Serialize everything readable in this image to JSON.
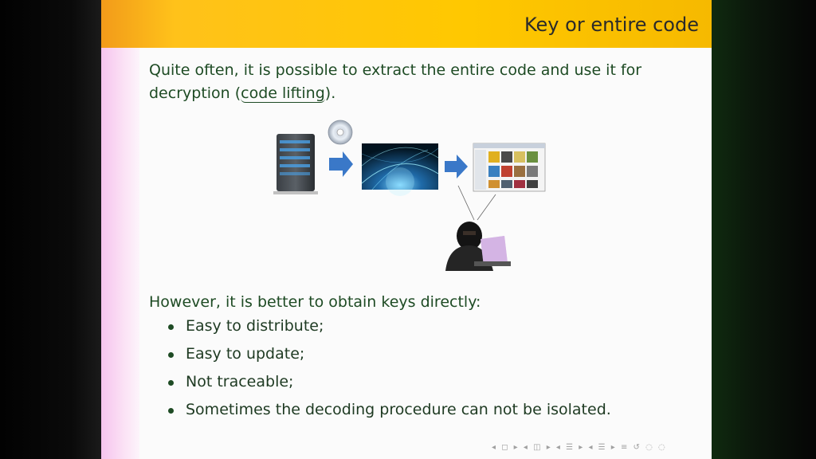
{
  "slide": {
    "title": "Key or entire code",
    "intro_line1": "Quite often, it is possible to extract the entire code and use it for",
    "intro_line2_pre": "decryption (",
    "intro_link": "code lifting",
    "intro_line2_post": ").",
    "however": "However, it is better to obtain keys directly:",
    "bullets": [
      "Easy to distribute;",
      "Easy to update;",
      "Not traceable;",
      "Sometimes the decoding procedure can not be isolated."
    ]
  },
  "icons": {
    "server": "server-icon",
    "disc": "cd-disc-icon",
    "arrow": "arrow-right-icon",
    "network": "network-globe-image",
    "screen": "media-library-screenshot",
    "hacker": "hacker-laptop-image"
  },
  "colors": {
    "header": "#ffc800",
    "text": "#1e4b24",
    "arrow": "#3a78c8"
  }
}
